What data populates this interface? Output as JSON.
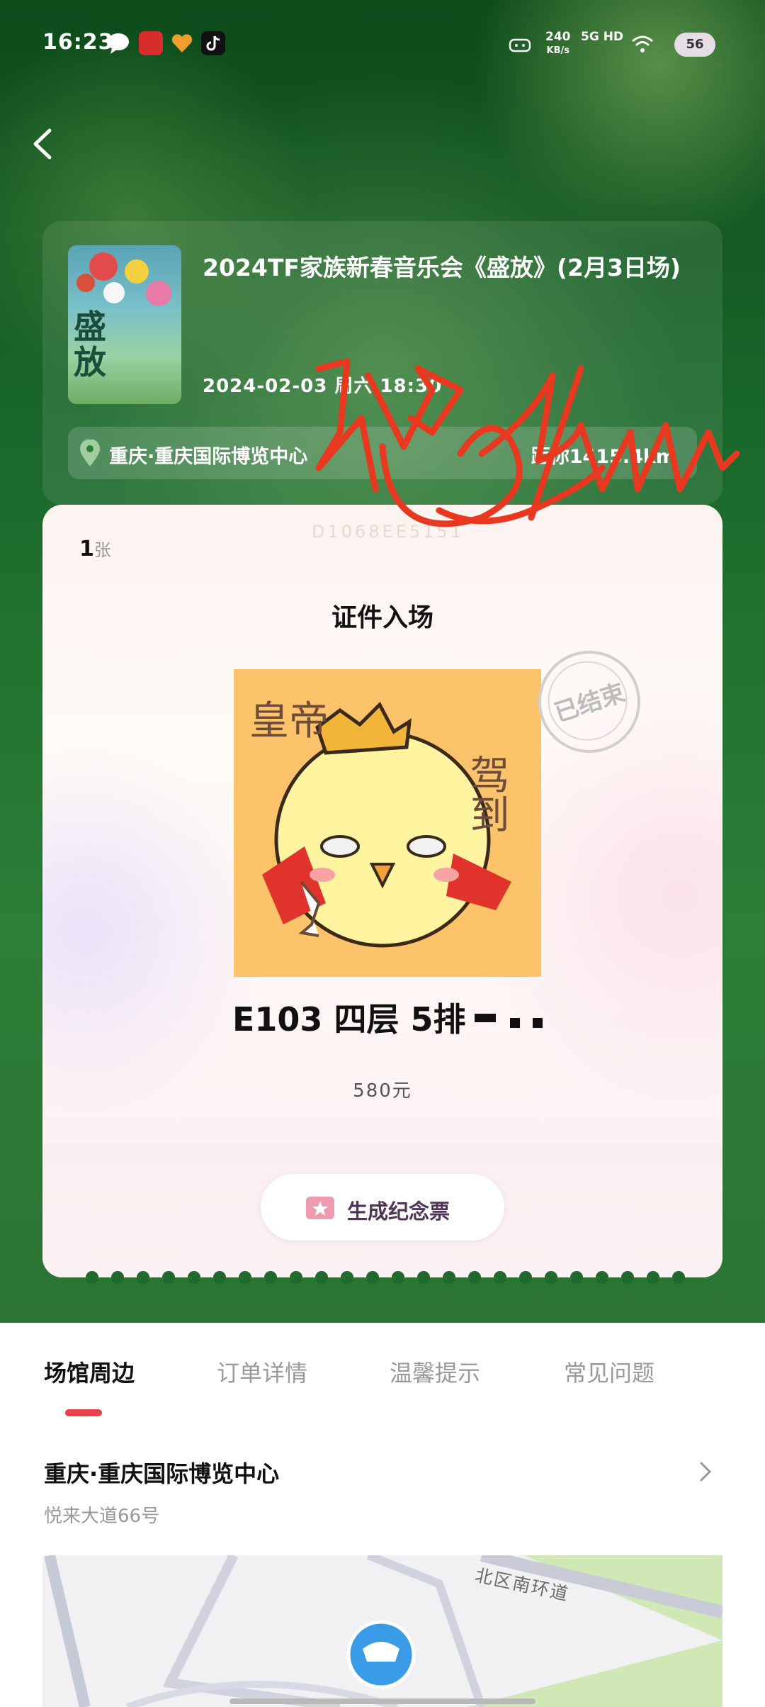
{
  "status_bar": {
    "time": "16:23",
    "net_speed_value": "240",
    "net_speed_unit": "KB/s",
    "network": "5G HD",
    "battery": "56"
  },
  "event": {
    "title": "2024TF家族新春音乐会《盛放》(2月3日场)",
    "poster_text": "盛放",
    "datetime": "2024-02-03 周六 18:30",
    "venue": "重庆·重庆国际博览中心",
    "distance": "距你1415.4km"
  },
  "ticket": {
    "count_number": "1",
    "count_unit": "张",
    "serial": "D1068EE5151",
    "entry_method": "证件入场",
    "status_stamp": "已结束",
    "seat": "E103 四层 5排",
    "price": "580元",
    "souvenir_button": "生成纪念票"
  },
  "sticker": {
    "left_text": "皇帝",
    "right_text": "驾到"
  },
  "tabs": [
    "场馆周边",
    "订单详情",
    "温馨提示",
    "常见问题"
  ],
  "venue_section": {
    "name": "重庆·重庆国际博览中心",
    "address": "悦来大道66号",
    "map_road_label": "北区南环道"
  },
  "colors": {
    "tab_underline": "#e8434b",
    "scribble": "#e8381f",
    "hero_green": "#1b6a2c"
  }
}
